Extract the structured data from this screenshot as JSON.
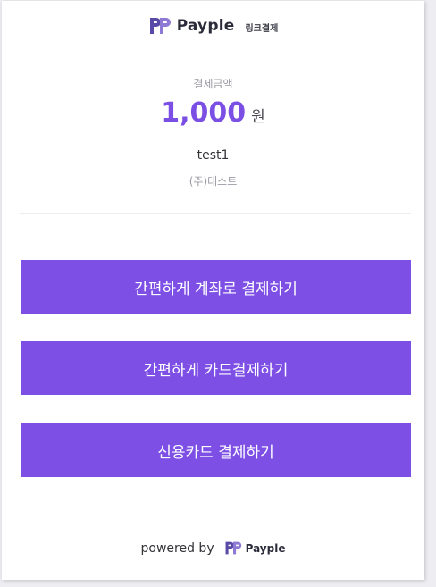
{
  "header": {
    "brand": "Payple",
    "subtitle": "링크결제",
    "logo_icon": "payple-logo-icon"
  },
  "payment": {
    "amount_label": "결제금액",
    "amount": "1,000",
    "currency": "원",
    "product_name": "test1",
    "merchant_name": "(주)테스트"
  },
  "buttons": {
    "account_pay": "간편하게 계좌로 결제하기",
    "card_pay": "간편하게 카드결제하기",
    "credit_card_pay": "신용카드 결제하기"
  },
  "footer": {
    "powered_by": "powered by",
    "brand": "Payple"
  },
  "colors": {
    "accent": "#7d4fe5",
    "logo_purple": "#6f5bbd"
  }
}
